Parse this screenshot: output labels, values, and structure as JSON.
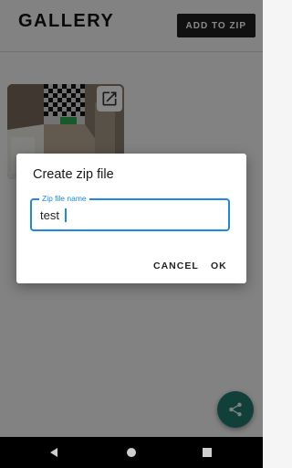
{
  "app": {
    "title": "GALLERY",
    "add_to_zip_label": "ADD TO ZIP"
  },
  "gallery": {
    "items": [
      {
        "icon": "open-in-new-icon"
      }
    ]
  },
  "dialog": {
    "title": "Create zip file",
    "field_label": "Zip file name",
    "field_value": "test",
    "cancel_label": "CANCEL",
    "ok_label": "OK"
  },
  "fab": {
    "icon": "share-icon"
  },
  "system_nav": {
    "back_icon": "back-triangle-icon",
    "home_icon": "home-circle-icon",
    "recents_icon": "recents-square-icon"
  },
  "colors": {
    "accent": "#1e88e5",
    "fab": "#1f7a6c",
    "topbar_button": "#1f1f1f"
  }
}
